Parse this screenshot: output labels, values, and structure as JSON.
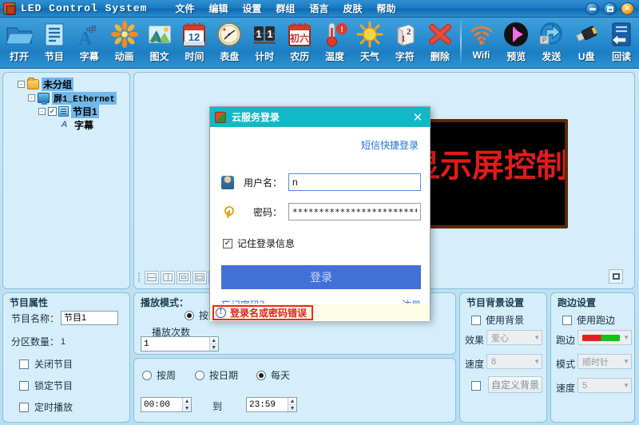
{
  "window": {
    "title": "LED Control System",
    "app_icon": "led-app-icon",
    "minimize_label": "–",
    "restore_label": "□",
    "close_label": "✕"
  },
  "menubar": {
    "items": [
      {
        "label": "文件",
        "name": "menu-file"
      },
      {
        "label": "编辑",
        "name": "menu-edit"
      },
      {
        "label": "设置",
        "name": "menu-settings"
      },
      {
        "label": "群组",
        "name": "menu-group"
      },
      {
        "label": "语言",
        "name": "menu-language"
      },
      {
        "label": "皮肤",
        "name": "menu-skin"
      },
      {
        "label": "帮助",
        "name": "menu-help"
      }
    ]
  },
  "toolbar": {
    "buttons": [
      {
        "label": "打开",
        "icon": "open-folder-icon"
      },
      {
        "label": "节目",
        "icon": "program-icon"
      },
      {
        "label": "字幕",
        "icon": "subtitle-icon"
      },
      {
        "label": "动画",
        "icon": "animation-icon"
      },
      {
        "label": "图文",
        "icon": "image-text-icon"
      },
      {
        "label": "时间",
        "icon": "calendar-icon"
      },
      {
        "label": "表盘",
        "icon": "analog-clock-icon"
      },
      {
        "label": "计时",
        "icon": "timer-icon"
      },
      {
        "label": "农历",
        "icon": "lunar-calendar-icon"
      },
      {
        "label": "温度",
        "icon": "thermometer-icon"
      },
      {
        "label": "天气",
        "icon": "weather-sun-icon"
      },
      {
        "label": "字符",
        "icon": "character-icon"
      },
      {
        "label": "删除",
        "icon": "delete-x-icon"
      },
      {
        "label": "Wifi",
        "icon": "wifi-icon"
      },
      {
        "label": "预览",
        "icon": "preview-play-icon"
      },
      {
        "label": "发送",
        "icon": "send-icon"
      },
      {
        "label": "U盘",
        "icon": "usb-drive-icon"
      },
      {
        "label": "回读",
        "icon": "readback-icon"
      }
    ],
    "separator_after_index": 12
  },
  "tree": {
    "nodes": [
      {
        "label": "未分组",
        "icon": "folder-icon",
        "expander": "-",
        "selected": true,
        "depth": 0
      },
      {
        "label": "屏1_Ethernet",
        "icon": "monitor-icon",
        "expander": "-",
        "selected": true,
        "depth": 1
      },
      {
        "label": "节目1",
        "icon": "program-icon",
        "expander": "-",
        "selected": true,
        "checked": true,
        "check_mark": "✓",
        "depth": 2
      },
      {
        "label": "字幕",
        "icon": "subtitle-icon",
        "expander": "",
        "selected": false,
        "depth": 3
      }
    ]
  },
  "preview": {
    "screen_text": "显示屏控制",
    "screen_text_color": "#e01b1b",
    "frame_color": "#5a2a0c",
    "partition_buttons": [
      "split-horizontal",
      "split-vertical",
      "single-area",
      "left-area",
      "right-area"
    ],
    "move_handle": "move-handle"
  },
  "program_properties": {
    "title": "节目属性",
    "name_label": "节目名称：",
    "name_value": "节目1",
    "partition_count_label": "分区数量：",
    "partition_count_value": "1",
    "checkboxes": [
      {
        "label": "关闭节目",
        "checked": false
      },
      {
        "label": "锁定节目",
        "checked": false
      },
      {
        "label": "定时播放",
        "checked": false
      }
    ]
  },
  "play_mode": {
    "title": "播放模式：",
    "radio_label": "按次数",
    "radio_selected": true,
    "count_label": "播放次数",
    "count_value": "1"
  },
  "schedule": {
    "options": [
      {
        "label": "按周",
        "selected": false
      },
      {
        "label": "按日期",
        "selected": false
      },
      {
        "label": "每天",
        "selected": true
      }
    ],
    "time_from": "00:00",
    "time_to_label": "到",
    "time_until": "23:59"
  },
  "background": {
    "title": "节目背景设置",
    "use_label": "使用背景",
    "use_checked": false,
    "effect_label": "效果",
    "effect_value": "爱心",
    "speed_label": "速度",
    "speed_value": "8",
    "custom_checked": false,
    "custom_button": "自定义背景"
  },
  "edge_settings": {
    "title": "跑边设置",
    "use_label": "使用跑边",
    "use_checked": false,
    "edge_label": "跑边",
    "edge_swatch_colors": [
      "#e02020",
      "#17c217"
    ],
    "mode_label": "模式",
    "mode_value": "顺时针",
    "speed_label": "速度",
    "speed_value": "5"
  },
  "login_dialog": {
    "title": "云服务登录",
    "icon": "led-app-icon",
    "close_label": "✕",
    "sms_link": "短信快捷登录",
    "username_label": "用户名：",
    "username_value": "n",
    "username_icon": "user-icon",
    "password_label": "密码：",
    "password_value": "**********************************",
    "password_icon": "key-icon",
    "remember_label": "记住登录信息",
    "remember_checked": true,
    "remember_mark": "✓",
    "login_button": "登录",
    "forgot_link": "忘记密码？",
    "register_link": "注册",
    "error_text": "登录名或密码错误",
    "error_icon": "info-icon",
    "error_icon_label": "!",
    "accent_color": "#0fb9c6",
    "button_color": "#4271d6",
    "error_color": "#e02020"
  }
}
